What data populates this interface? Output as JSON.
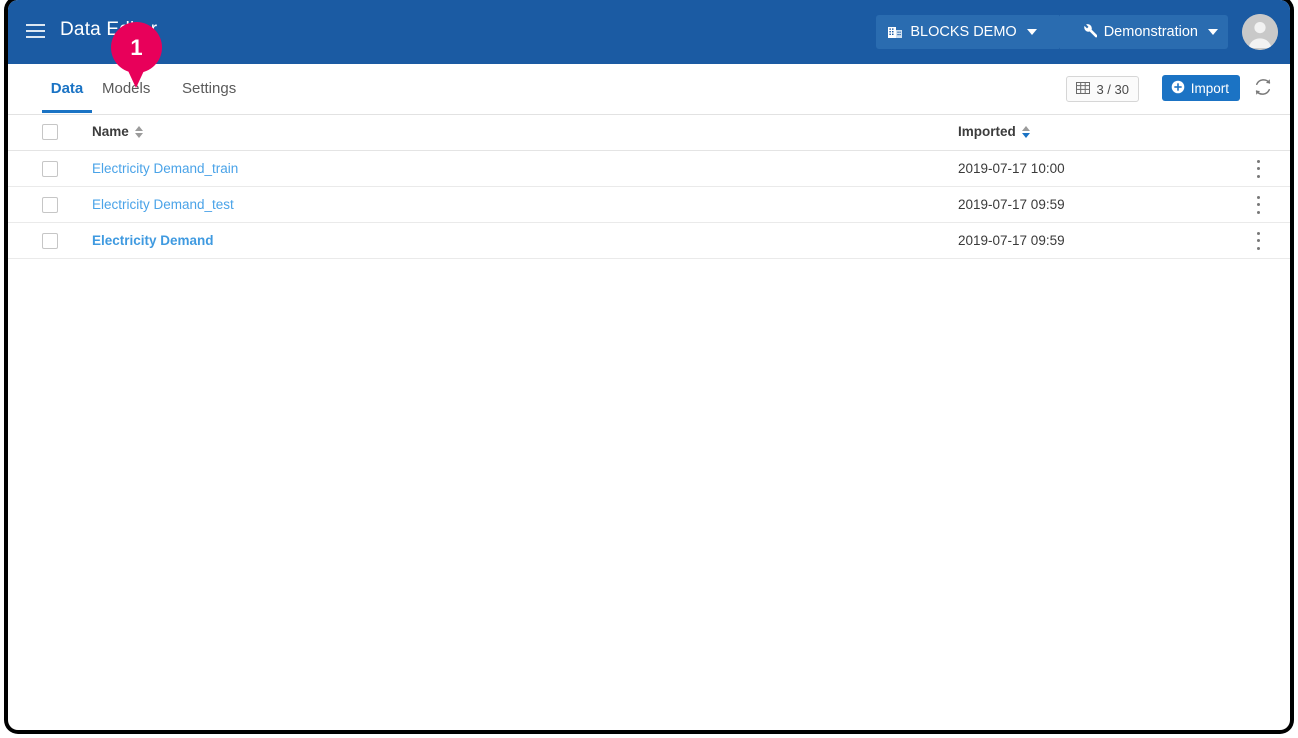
{
  "window": {
    "frame_border_color": "#000000",
    "background": "#ffffff"
  },
  "app_bar": {
    "title": "Data Editor",
    "background_color": "#1b5ba3",
    "menu_icon": "hamburger-menu-icon",
    "context": {
      "workspace": {
        "label": "BLOCKS DEMO",
        "icon": "building-icon",
        "caret": "chevron-down-icon"
      },
      "environment": {
        "label": "Demonstration",
        "icon": "wrench-icon",
        "caret": "chevron-down-icon"
      }
    },
    "avatar": {
      "icon": "user-avatar-icon"
    }
  },
  "tabs": [
    {
      "label": "Data",
      "active": true
    },
    {
      "label": "Models",
      "active": false
    },
    {
      "label": "Settings",
      "active": false
    }
  ],
  "toolbar": {
    "count_label": "3 / 30",
    "count_icon": "table-icon",
    "import_label": "Import",
    "import_icon": "plus-circle-icon",
    "import_color": "#1b73c4",
    "refresh_icon": "refresh-icon"
  },
  "table": {
    "columns": [
      {
        "label": "Name",
        "sort": "none"
      },
      {
        "label": "Imported",
        "sort": "desc"
      }
    ],
    "rows": [
      {
        "name": "Electricity Demand_train",
        "imported": "2019-07-17 10:00",
        "selected": false
      },
      {
        "name": "Electricity Demand_test",
        "imported": "2019-07-17 09:59",
        "selected": false
      },
      {
        "name": "Electricity Demand",
        "imported": "2019-07-17 09:59",
        "selected": false
      }
    ],
    "link_color": "#4aa3e8",
    "row_menu_icon": "kebab-menu-icon"
  },
  "annotation": {
    "step_number": "1",
    "color": "#e8005a"
  }
}
